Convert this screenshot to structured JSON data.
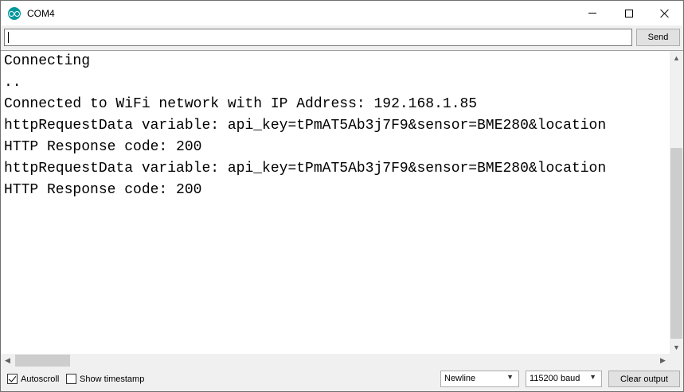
{
  "window": {
    "title": "COM4"
  },
  "input": {
    "value": "",
    "send_label": "Send"
  },
  "console": {
    "lines": [
      "Connecting",
      "..",
      "Connected to WiFi network with IP Address: 192.168.1.85",
      "httpRequestData variable: api_key=tPmAT5Ab3j7F9&sensor=BME280&location",
      "HTTP Response code: 200",
      "httpRequestData variable: api_key=tPmAT5Ab3j7F9&sensor=BME280&location",
      "HTTP Response code: 200"
    ]
  },
  "footer": {
    "autoscroll_label": "Autoscroll",
    "autoscroll_checked": true,
    "timestamp_label": "Show timestamp",
    "timestamp_checked": false,
    "line_ending": "Newline",
    "baud_rate": "115200 baud",
    "clear_label": "Clear output"
  },
  "icons": {
    "app": "arduino-icon",
    "minimize": "minimize-icon",
    "maximize": "maximize-icon",
    "close": "close-icon"
  },
  "colors": {
    "app_icon": "#00979d"
  }
}
